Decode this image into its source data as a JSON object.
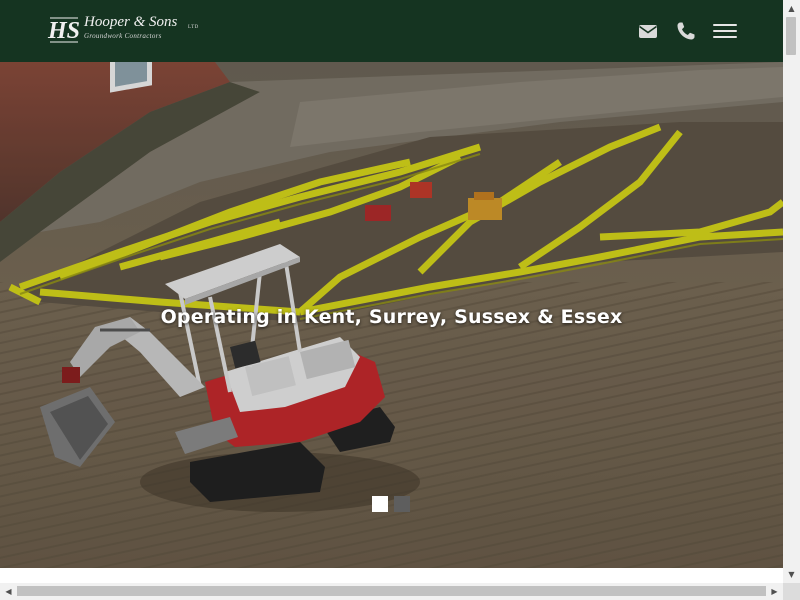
{
  "header": {
    "logo": {
      "monogram": "HS",
      "name": "Hooper & Sons",
      "suffix": "LTD",
      "tagline": "Groundwork Contractors"
    },
    "icons": {
      "mail": "envelope-icon",
      "phone": "phone-icon",
      "menu": "hamburger-menu-icon"
    },
    "colors": {
      "background": "#153421",
      "icon": "#d9d9d9"
    }
  },
  "hero": {
    "caption": "Operating in Kent, Surrey, Sussex & Essex",
    "slides": {
      "count": 2,
      "active": 1
    },
    "colors": {
      "rebar": "#d7d619",
      "excavator_body": "#c3272b",
      "dot_active": "#ffffff",
      "dot_inactive": "#5e5e5e"
    }
  },
  "scrollbars": {
    "vertical": true,
    "horizontal": true
  }
}
